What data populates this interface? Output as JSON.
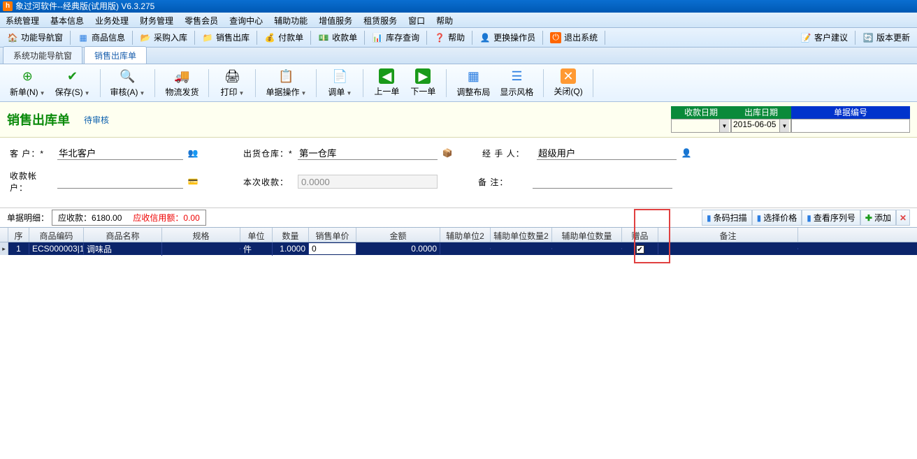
{
  "app": {
    "title": "象过河软件--经典版(试用版)  V6.3.275"
  },
  "menu": {
    "items": [
      "系统管理",
      "基本信息",
      "业务处理",
      "财务管理",
      "零售会员",
      "查询中心",
      "辅助功能",
      "增值服务",
      "租赁服务",
      "窗口",
      "帮助"
    ]
  },
  "main_toolbar": {
    "nav": "功能导航窗",
    "goods": "商品信息",
    "purchase": "采购入库",
    "sales": "销售出库",
    "payment": "付款单",
    "receipt": "收款单",
    "inventory": "库存查询",
    "help": "帮助",
    "switch_user": "更换操作员",
    "exit": "退出系统",
    "suggest": "客户建议",
    "update": "版本更新"
  },
  "tabs": {
    "items": [
      "系统功能导航窗",
      "销售出库单"
    ]
  },
  "doc_toolbar": {
    "new": "新单(N)",
    "save": "保存(S)",
    "audit": "审核(A)",
    "ship": "物流发货",
    "print": "打印",
    "billop": "单据操作",
    "transfer": "调单",
    "prev": "上一单",
    "next": "下一单",
    "layout": "调整布局",
    "style": "显示风格",
    "close": "关闭(Q)"
  },
  "doc": {
    "title": "销售出库单",
    "status": "待审核"
  },
  "dates": {
    "receipt_label": "收款日期",
    "out_label": "出库日期",
    "billno_label": "单据编号",
    "receipt_value": "",
    "out_value": "2015-06-05",
    "billno_value": ""
  },
  "form": {
    "customer_label": "客    户：*",
    "customer_value": "华北客户",
    "warehouse_label": "出货仓库：*",
    "warehouse_value": "第一仓库",
    "handler_label": "经 手 人：",
    "handler_value": "超级用户",
    "account_label": "收款帐户：",
    "account_value": "",
    "thisreceipt_label": "本次收款：",
    "thisreceipt_value": "0.0000",
    "remark_label": "备    注：",
    "remark_value": ""
  },
  "detail": {
    "label": "单据明细：",
    "receivable": "应收款：6180.00",
    "credit": "应收信用额：0.00"
  },
  "actions": {
    "barcode": "条码扫描",
    "price": "选择价格",
    "cols": "查看序列号",
    "add": "添加"
  },
  "grid": {
    "headers": [
      "序号",
      "商品编码",
      "商品名称",
      "规格",
      "单位",
      "数量",
      "销售单价",
      "金额",
      "辅助单位2",
      "辅助单位数量2",
      "辅助单位数量",
      "赠品",
      "备注"
    ],
    "widths": [
      30,
      78,
      112,
      112,
      46,
      52,
      68,
      120,
      72,
      88,
      100,
      52,
      200
    ],
    "row": {
      "seq": "1",
      "code": "ECS000003|1",
      "name": "调味品",
      "spec": "",
      "unit": "件",
      "qty": "1.0000",
      "price": "0",
      "amount": "0.0000",
      "aux2": "",
      "auxqty2": "",
      "auxqty": "",
      "gift_checked": true,
      "remark": ""
    }
  }
}
